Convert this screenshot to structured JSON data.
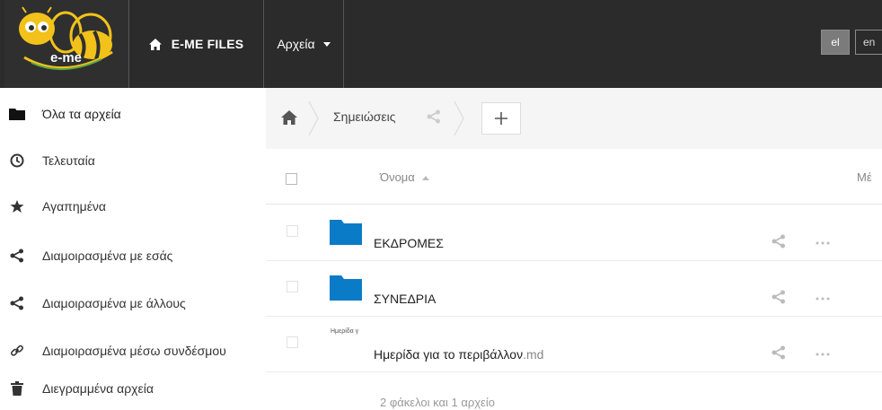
{
  "topbar": {
    "logo_text": "e-me",
    "brand_label": "E-ME FILES",
    "files_menu_label": "Αρχεία",
    "lang_active": "el",
    "lang_other": "en"
  },
  "sidebar": {
    "items": [
      {
        "label": "Όλα τα αρχεία",
        "icon": "folder-icon"
      },
      {
        "label": "Τελευταία",
        "icon": "clock-icon"
      },
      {
        "label": "Αγαπημένα",
        "icon": "star-icon"
      },
      {
        "label": "Διαμοιρασμένα με εσάς",
        "icon": "share-icon"
      },
      {
        "label": "Διαμοιρασμένα με άλλους",
        "icon": "share-icon"
      },
      {
        "label": "Διαμοιρασμένα μέσω συνδέσμου",
        "icon": "link-icon"
      },
      {
        "label": "Διεγραμμένα αρχεία",
        "icon": "trash-icon"
      }
    ]
  },
  "breadcrumb": {
    "current": "Σημειώσεις"
  },
  "table": {
    "header_name": "Όνομα",
    "header_modified": "Μέ",
    "rows": [
      {
        "name": "ΕΚΔΡΟΜΕΣ",
        "type": "folder"
      },
      {
        "name": "ΣΥΝΕΔΡΙΑ",
        "type": "folder"
      },
      {
        "name": "Ημερίδα για το περιβάλλον",
        "ext": ".md",
        "type": "file",
        "thumb": "Ημερίδα γ"
      }
    ],
    "summary": "2 φάκελοι και 1 αρχείο"
  },
  "colors": {
    "topbar": "#2b2b2b",
    "folder": "#0a7cc7",
    "crumb_bg": "#f5f5f5"
  }
}
